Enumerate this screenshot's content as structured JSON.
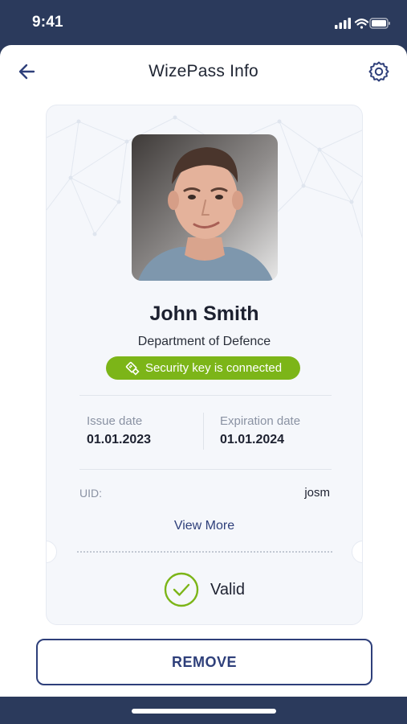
{
  "status_bar": {
    "time": "9:41"
  },
  "header": {
    "title": "WizePass Info"
  },
  "profile": {
    "name": "John Smith",
    "department": "Department of Defence",
    "security_badge": "Security key is connected"
  },
  "dates": {
    "issue_label": "Issue date",
    "issue_value": "01.01.2023",
    "expiration_label": "Expiration date",
    "expiration_value": "01.01.2024"
  },
  "uid": {
    "label": "UID:",
    "value": "josm"
  },
  "view_more": "View More",
  "status": {
    "label": "Valid"
  },
  "actions": {
    "remove_label": "REMOVE"
  },
  "colors": {
    "primary": "#2e3f7a",
    "badge_green": "#7cb518",
    "valid_green": "#7cb518",
    "status_bar_bg": "#2b3a5c"
  },
  "icons": {
    "back": "arrow-left-icon",
    "settings": "gear-icon",
    "usb_key": "usb-key-icon",
    "valid": "check-circle-icon"
  }
}
